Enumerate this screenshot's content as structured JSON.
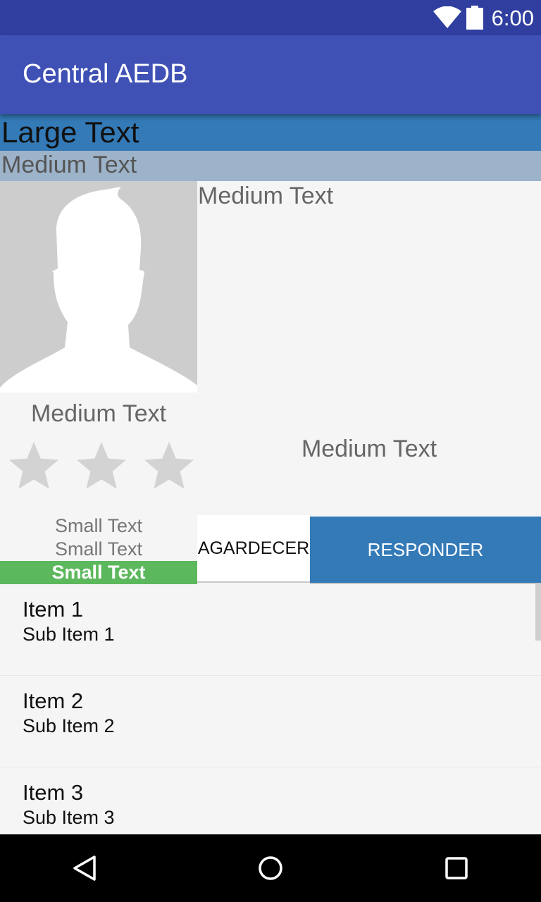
{
  "status_bar": {
    "time": "6:00",
    "icons": [
      "wifi-icon",
      "battery-icon"
    ]
  },
  "app_bar": {
    "title": "Central AEDB",
    "color": "#3f51b5"
  },
  "header": {
    "large_text": "Large Text",
    "medium_text": "Medium Text"
  },
  "profile": {
    "avatar": "person-silhouette-icon",
    "name_text": "Medium Text",
    "right_text_top": "Medium Text",
    "right_text_middle": "Medium Text",
    "rating": {
      "value": 0,
      "max": 3
    },
    "small_texts": [
      "Small Text",
      "Small Text",
      "Small Text"
    ]
  },
  "actions": {
    "thanks_label": "AGARDECER",
    "reply_label": "RESPONDER"
  },
  "list": {
    "items": [
      {
        "title": "Item 1",
        "subtitle": "Sub Item 1"
      },
      {
        "title": "Item 2",
        "subtitle": "Sub Item 2"
      },
      {
        "title": "Item 3",
        "subtitle": "Sub Item 3"
      }
    ]
  },
  "nav_bar": {
    "buttons": [
      "back-icon",
      "home-icon",
      "recents-icon"
    ]
  },
  "colors": {
    "status_bar": "#303f9f",
    "large_bar": "#337ab7",
    "medium_bar": "#9db3ca",
    "small_bar": "#5cb85c",
    "reply_button": "#337ab7"
  }
}
